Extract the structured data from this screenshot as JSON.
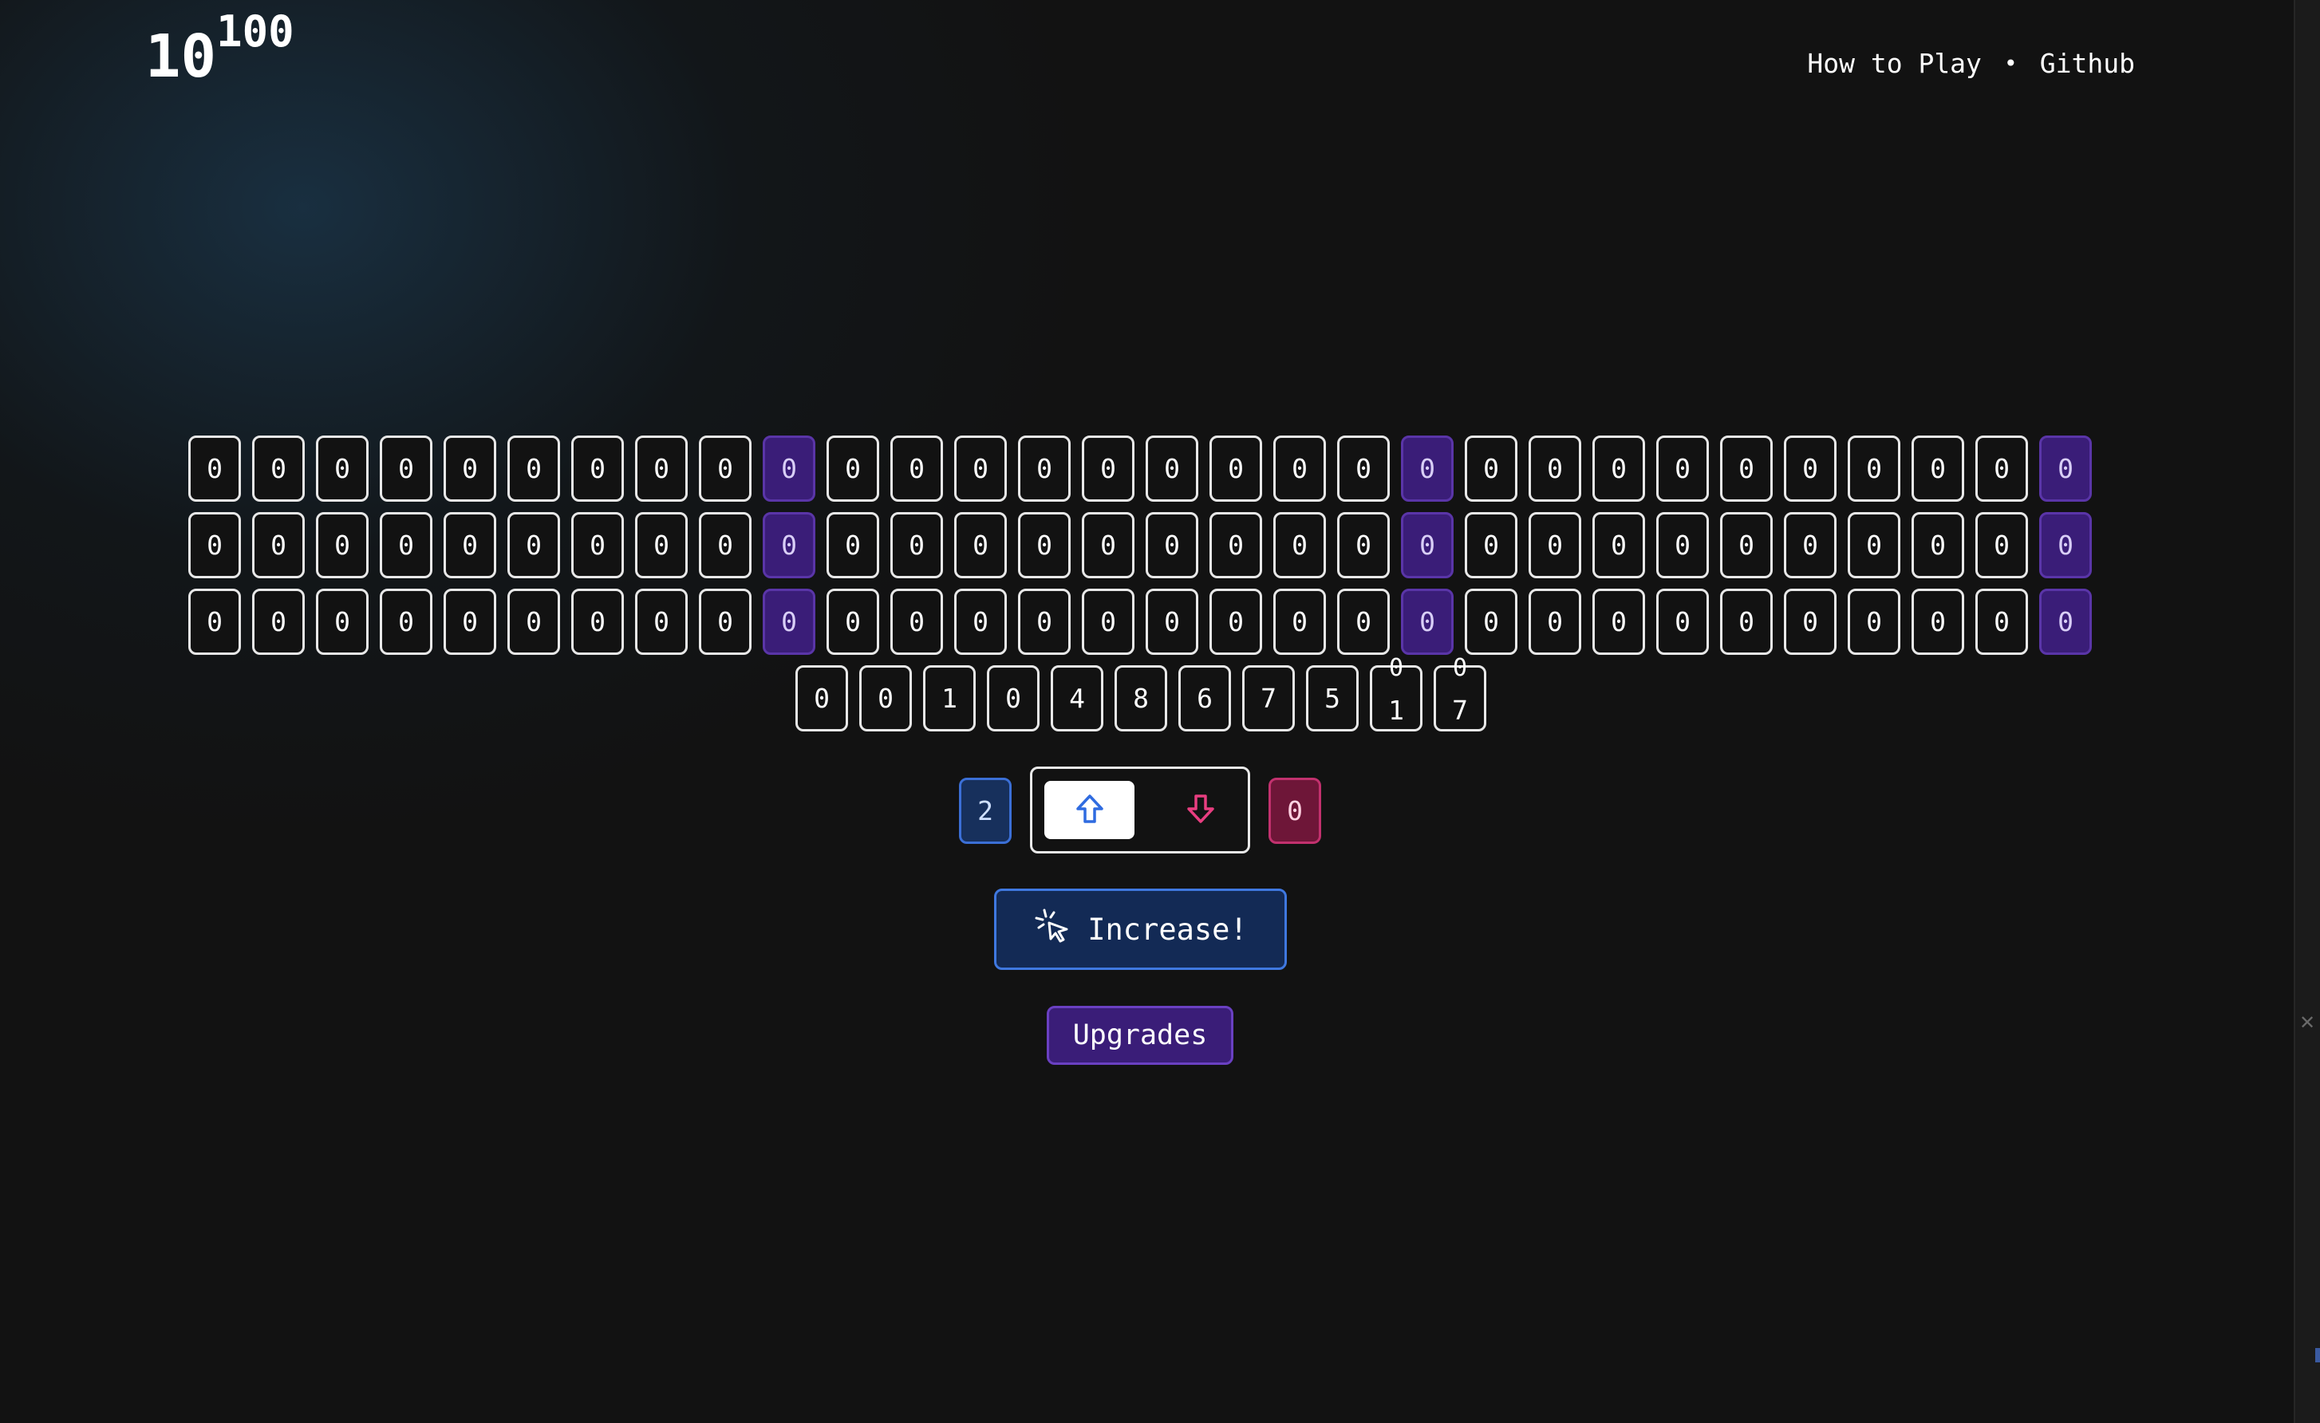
{
  "logo": {
    "base": "10",
    "exponent": "100"
  },
  "nav": {
    "how_to_play": "How to Play",
    "separator": "•",
    "github": "Github"
  },
  "grid": {
    "rows": [
      [
        "0",
        "0",
        "0",
        "0",
        "0",
        "0",
        "0",
        "0",
        "0",
        "0",
        "0",
        "0",
        "0",
        "0",
        "0",
        "0",
        "0",
        "0",
        "0",
        "0",
        "0",
        "0",
        "0",
        "0",
        "0",
        "0",
        "0",
        "0",
        "0",
        "0"
      ],
      [
        "0",
        "0",
        "0",
        "0",
        "0",
        "0",
        "0",
        "0",
        "0",
        "0",
        "0",
        "0",
        "0",
        "0",
        "0",
        "0",
        "0",
        "0",
        "0",
        "0",
        "0",
        "0",
        "0",
        "0",
        "0",
        "0",
        "0",
        "0",
        "0",
        "0"
      ],
      [
        "0",
        "0",
        "0",
        "0",
        "0",
        "0",
        "0",
        "0",
        "0",
        "0",
        "0",
        "0",
        "0",
        "0",
        "0",
        "0",
        "0",
        "0",
        "0",
        "0",
        "0",
        "0",
        "0",
        "0",
        "0",
        "0",
        "0",
        "0",
        "0",
        "0"
      ]
    ],
    "last_row": [
      "0",
      "0",
      "1",
      "0",
      "4",
      "8",
      "6",
      "7",
      "5",
      "1",
      "7"
    ],
    "last_row_peek": [
      "",
      "",
      "",
      "",
      "",
      "",
      "",
      "",
      "",
      "0",
      "0"
    ]
  },
  "controls": {
    "up_count": "2",
    "down_count": "0",
    "increase_label": "Increase!",
    "upgrades_label": "Upgrades"
  },
  "colors": {
    "background": "#121212",
    "purple_cell": "#3a1d78",
    "up_blue": "#3b6fd6",
    "down_pink": "#c2316e"
  },
  "icons": {
    "up": "arrow-up-icon",
    "down": "arrow-down-icon",
    "increase": "cursor-click-icon"
  }
}
